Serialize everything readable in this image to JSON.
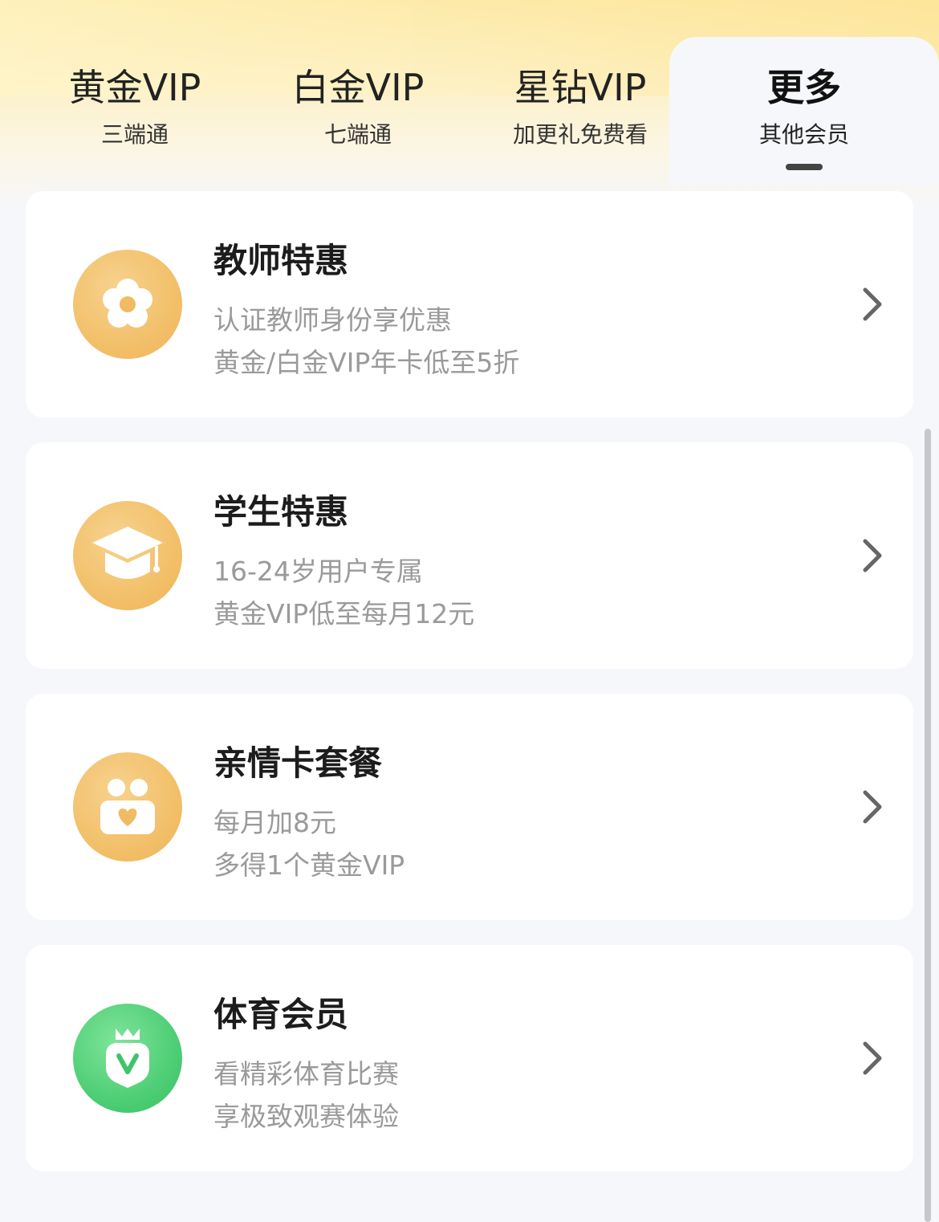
{
  "tabs": [
    {
      "label": "黄金VIP",
      "sub": "三端通",
      "active": false
    },
    {
      "label": "白金VIP",
      "sub": "七端通",
      "active": false
    },
    {
      "label": "星钻VIP",
      "sub": "加更礼免费看",
      "active": false
    },
    {
      "label": "更多",
      "sub": "其他会员",
      "active": true
    }
  ],
  "cards": [
    {
      "title": "教师特惠",
      "line1": "认证教师身份享优惠",
      "line2": "黄金/白金VIP年卡低至5折",
      "icon": "flower-icon"
    },
    {
      "title": "学生特惠",
      "line1": "16-24岁用户专属",
      "line2": "黄金VIP低至每月12元",
      "icon": "graduation-cap-icon"
    },
    {
      "title": "亲情卡套餐",
      "line1": "每月加8元",
      "line2": "多得1个黄金VIP",
      "icon": "family-heart-icon"
    },
    {
      "title": "体育会员",
      "line1": "看精彩体育比赛",
      "line2": "享极致观赛体验",
      "icon": "sports-v-crown-icon"
    }
  ],
  "colors": {
    "gold_badge": "#f2c06a",
    "green_badge": "#4fce76",
    "header_gold": "#fde9a8",
    "page_bg": "#f6f7fb"
  }
}
